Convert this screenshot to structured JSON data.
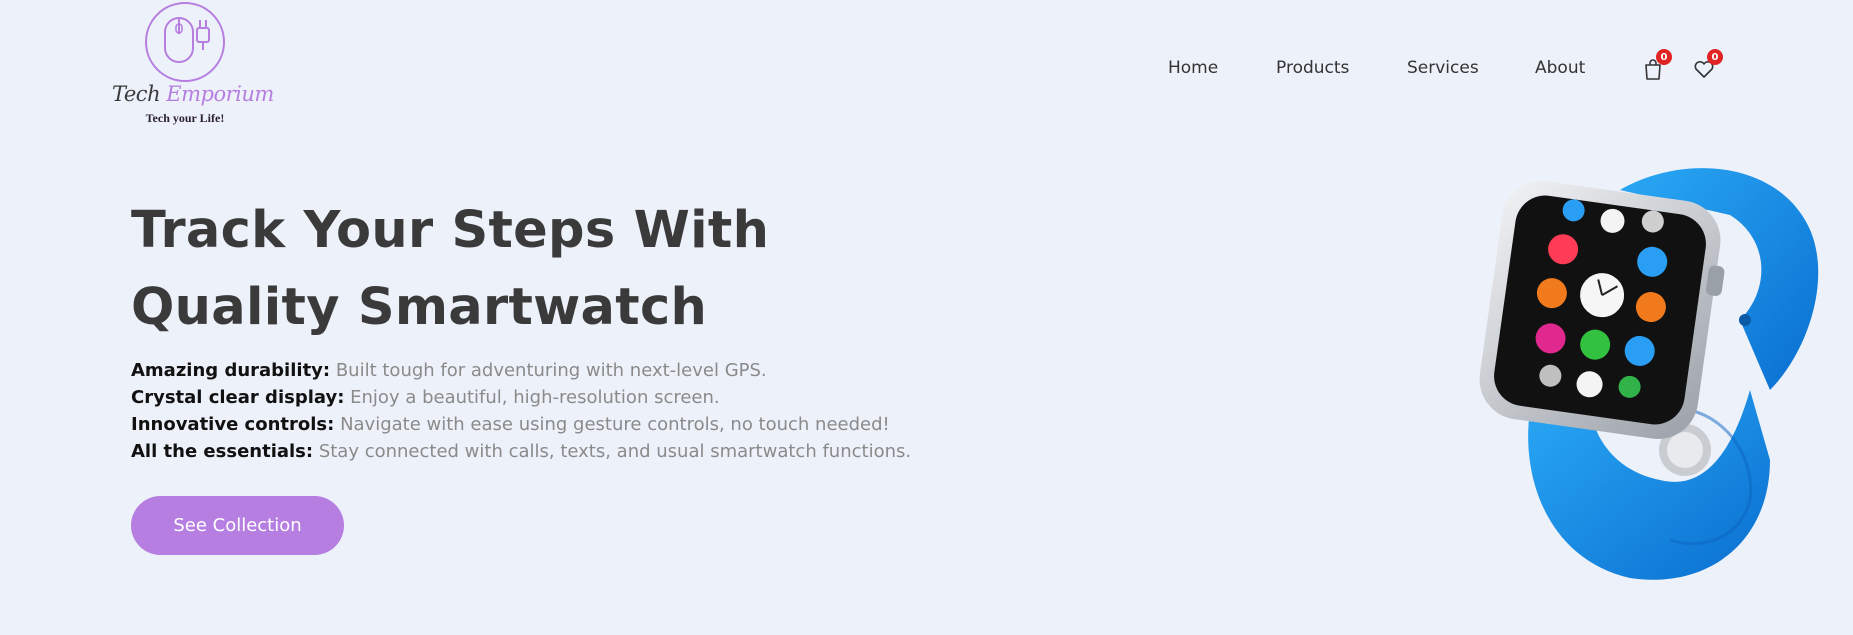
{
  "brand": {
    "name_part1": "Tech",
    "name_part2": "Emporium",
    "tagline": "Tech your Life!",
    "color": "#b57ee0"
  },
  "nav": {
    "items": [
      {
        "label": "Home"
      },
      {
        "label": "Products"
      },
      {
        "label": "Services"
      },
      {
        "label": "About"
      }
    ],
    "cart_count": "0",
    "wishlist_count": "0",
    "cart_icon": "shopping-bag-icon",
    "wishlist_icon": "heart-icon"
  },
  "hero": {
    "title": "Track Your Steps With Quality Smartwatch",
    "features": [
      {
        "label": "Amazing durability:",
        "text": " Built tough for adventuring with next-level GPS."
      },
      {
        "label": "Crystal clear display:",
        "text": " Enjoy a beautiful, high-resolution screen."
      },
      {
        "label": "Innovative controls:",
        "text": " Navigate with ease using gesture controls, no touch needed!"
      },
      {
        "label": "All the essentials:",
        "text": " Stay connected with calls, texts, and usual smartwatch functions."
      }
    ],
    "cta_label": "See Collection",
    "cta_color": "#b57ee0",
    "watch_band_color": "#1590e8"
  }
}
